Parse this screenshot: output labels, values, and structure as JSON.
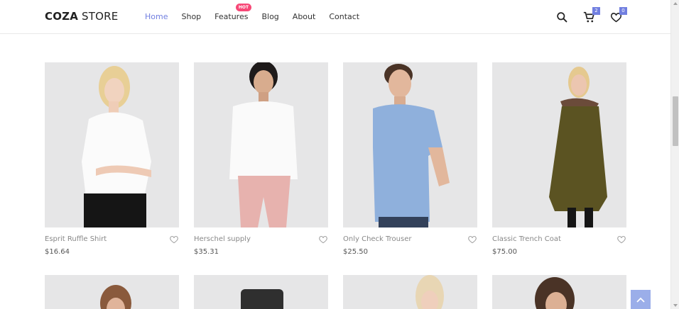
{
  "header": {
    "logo_bold": "COZA",
    "logo_light": " STORE",
    "nav": [
      {
        "label": "Home",
        "active": true
      },
      {
        "label": "Shop",
        "active": false
      },
      {
        "label": "Features",
        "active": false
      },
      {
        "label": "Blog",
        "active": false
      },
      {
        "label": "About",
        "active": false
      },
      {
        "label": "Contact",
        "active": false
      }
    ],
    "hot_badge": "HOT",
    "cart_count": "2",
    "wishlist_count": "0",
    "icons": [
      "search-icon",
      "cart-icon",
      "heart-icon"
    ]
  },
  "products": [
    {
      "name": "Esprit Ruffle Shirt",
      "price": "$16.64"
    },
    {
      "name": "Herschel supply",
      "price": "$35.31"
    },
    {
      "name": "Only Check Trouser",
      "price": "$25.50"
    },
    {
      "name": "Classic Trench Coat",
      "price": "$75.00"
    }
  ],
  "colors": {
    "accent": "#717fe0",
    "hot": "#f74877",
    "back_to_top": "#8aa0e6"
  }
}
